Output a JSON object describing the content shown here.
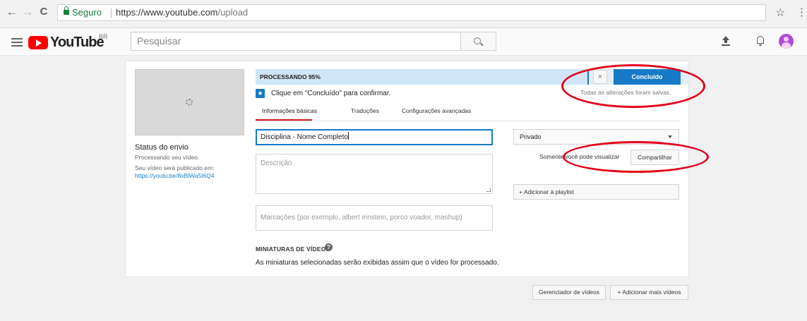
{
  "browser": {
    "back": "←",
    "forward": "→",
    "reload": "C",
    "secure_label": "Seguro",
    "url_host": "https://www.youtube.com",
    "url_path": "/upload",
    "bookmark": "☆",
    "menu": "⋮"
  },
  "masthead": {
    "logo_text": "YouTube",
    "region": "BR",
    "search_placeholder": "Pesquisar",
    "icons": [
      "menu-icon",
      "search-icon",
      "upload-icon",
      "notifications-icon",
      "account-avatar"
    ]
  },
  "upload": {
    "progress_label": "PROCESSANDO 95%",
    "progress_percent": 95,
    "close_label": "×",
    "done_label": "Concluído",
    "saved_note": "Todas as alterações foram salvas.",
    "confirm_text": "Clique em \"Concluído\" para confirmar.",
    "tabs": [
      {
        "label": "Informações básicas",
        "active": true
      },
      {
        "label": "Traduções",
        "active": false
      },
      {
        "label": "Configurações avançadas",
        "active": false
      }
    ],
    "title_value": "Disciplina - Nome Completo",
    "description_placeholder": "Descrição",
    "tags_placeholder": "Marcações (por exemplo, albert einstein, porco voador, mashup)",
    "thumbnails_title": "MINIATURAS DE VÍDEOS",
    "thumbnails_note": "As miniaturas selecionadas serão exibidas assim que o vídeo for processado.",
    "privacy_value": "Privado",
    "only_you": "Somente você pode visualizar",
    "share_label": "Compartilhar",
    "playlist_label": "+ Adicionar à playlist"
  },
  "status": {
    "title": "Status do envio",
    "processing": "Processando seu vídeo.",
    "publish_at": "Seu vídeo será publicado em:",
    "link": "https://youtu.be/8xBlWa5I6Q4"
  },
  "footer": {
    "video_manager": "Gerenciador de vídeos",
    "add_more": "+ Adicionar mais vídeos"
  },
  "colors": {
    "brand_red": "#ff0000",
    "primary_blue": "#167ac6",
    "progress_bg": "#cfe5f8",
    "annotation_red": "#e4001b"
  }
}
